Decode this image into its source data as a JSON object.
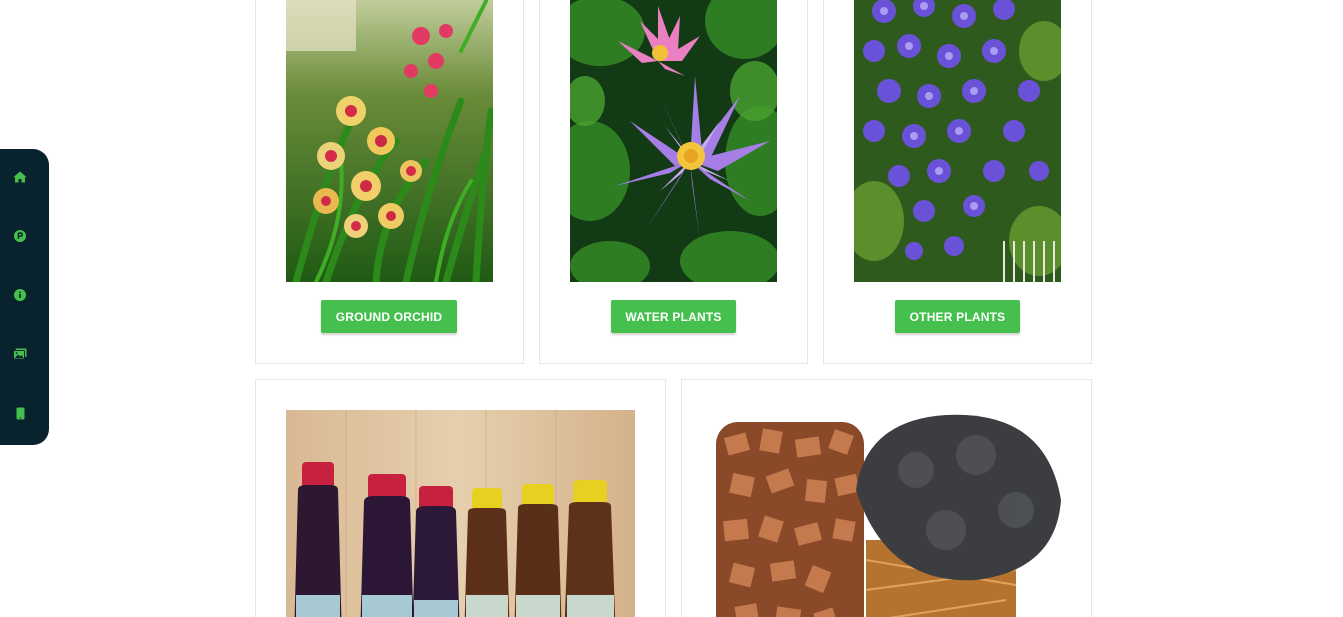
{
  "colors": {
    "sidenav_bg": "#08222e",
    "accent_green": "#45c04e",
    "card_border": "#e6e6e6"
  },
  "sidenav": {
    "items": [
      {
        "icon": "home-icon"
      },
      {
        "icon": "parking-circle-icon"
      },
      {
        "icon": "info-circle-icon"
      },
      {
        "icon": "gallery-icon"
      },
      {
        "icon": "mobile-phone-icon"
      }
    ]
  },
  "categories": [
    {
      "label": "GROUND ORCHID",
      "image": "orchid-photo"
    },
    {
      "label": "WATER PLANTS",
      "image": "water-lily-photo"
    },
    {
      "label": "OTHER PLANTS",
      "image": "purple-vine-photo"
    }
  ],
  "products": [
    {
      "image": "liquid-fertilizer-bottles-photo"
    },
    {
      "image": "coco-chips-and-peat-photo"
    }
  ]
}
